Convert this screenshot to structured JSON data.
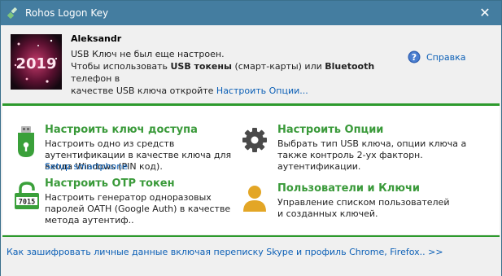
{
  "window": {
    "title": "Rohos Logon Key",
    "close_glyph": "✕",
    "colors": {
      "titlebar": "#447da0",
      "accent_green": "#2d9a2d",
      "link_blue": "#0b5fb6",
      "title_green": "#3a9a3a"
    }
  },
  "header": {
    "username": "Aleksandr",
    "avatar_text": "2019",
    "status_line1": "USB Ключ не был еще настроен.",
    "status_line2_pre": "Чтобы использовать ",
    "status_line2_b1": "USB токены",
    "status_line2_mid": " (смарт-карты) или ",
    "status_line2_b2": "Bluetooth",
    "status_line2_post": " телефон в",
    "status_line3_pre": "качестве USB ключа откройте ",
    "status_line3_link": "Настроить Опции...",
    "help_label": "Справка",
    "help_icon": "question-circle-icon"
  },
  "tiles": {
    "access_key": {
      "title": "Настроить ключ доступа",
      "desc": "Настроить одно из средств аутентификации в качестве ключа для входа Windows (PIN код).",
      "sub_link": "Setup smartphone",
      "icon": "usb-key-icon"
    },
    "options": {
      "title": "Настроить Опции",
      "desc": "Выбрать тип USB ключа, опции ключа а также контроль 2-ух факторн. аутентификации.",
      "icon": "gear-icon"
    },
    "otp": {
      "title": "Настроить OTP токен",
      "desc": "Настроить генератор одноразовых паролей OATH (Google Auth) в качестве метода аутентиф..",
      "icon": "otp-lock-icon",
      "icon_text": "7015"
    },
    "users": {
      "title": "Пользователи и Ключи",
      "desc": "Управление списком пользователей и созданных ключей.",
      "icon": "user-icon"
    }
  },
  "footer": {
    "link": "Как зашифровать личные данные включая переписку Skype и профиль Chrome, Firefox.. >>"
  }
}
